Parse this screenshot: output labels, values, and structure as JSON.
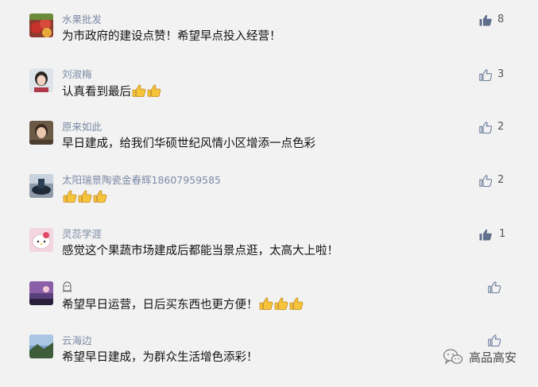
{
  "comments": [
    {
      "nickname": "水果批发",
      "text": "为市政府的建设点赞！希望早点投入经营！",
      "likes": "8",
      "liked": true
    },
    {
      "nickname": "刘淑梅",
      "text": "认真看到最后",
      "likes": "3",
      "liked": false
    },
    {
      "nickname": "原来如此",
      "text": "早日建成，给我们华硕世纪风情小区增添一点色彩",
      "likes": "2",
      "liked": false
    },
    {
      "nickname": "太阳瑞景陶瓷金春辉18607959585",
      "text": "",
      "likes": "2",
      "liked": false
    },
    {
      "nickname": "灵蕊学涯",
      "text": "感觉这个果蔬市场建成后都能当景点逛，太高大上啦！",
      "likes": "1",
      "liked": true
    },
    {
      "nickname": "",
      "text": "希望早日运营，日后买东西也更方便！",
      "likes": "",
      "liked": false
    },
    {
      "nickname": "云海边",
      "text": "希望早日建成，为群众生活增色添彩！",
      "likes": "",
      "liked": false
    }
  ],
  "emoji": {
    "name": "thumbs-up-emoji"
  },
  "watermark": {
    "text": "高品高安",
    "icon": "wechat-icon"
  },
  "colors": {
    "background": "#f2f2f2",
    "nickname": "#7b8aa6",
    "like_active": "#5f6f8c",
    "like_idle": "#6a7a9a",
    "emoji": "#f6c43a"
  }
}
